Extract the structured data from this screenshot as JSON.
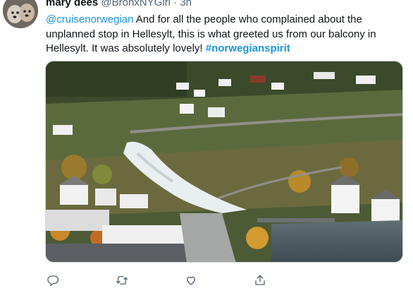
{
  "tweet": {
    "author_name": "mary dees",
    "author_handle": "@BronxNYGirl",
    "separator": "·",
    "time": "3h",
    "mention": "@cruisenorwegian",
    "text_part1": " And for all the people who complained about the unplanned stop in Hellesylt, this is what greeted us from our balcony in Hellesylt.  It was absolutely lovely! ",
    "hashtag": "#norwegianspirit"
  },
  "actions": {
    "icons": [
      "reply-icon",
      "retweet-icon",
      "like-icon",
      "share-icon"
    ]
  },
  "colors": {
    "link": "#1b95e0",
    "secondary_text": "#536471",
    "primary_text": "#0f1419"
  }
}
